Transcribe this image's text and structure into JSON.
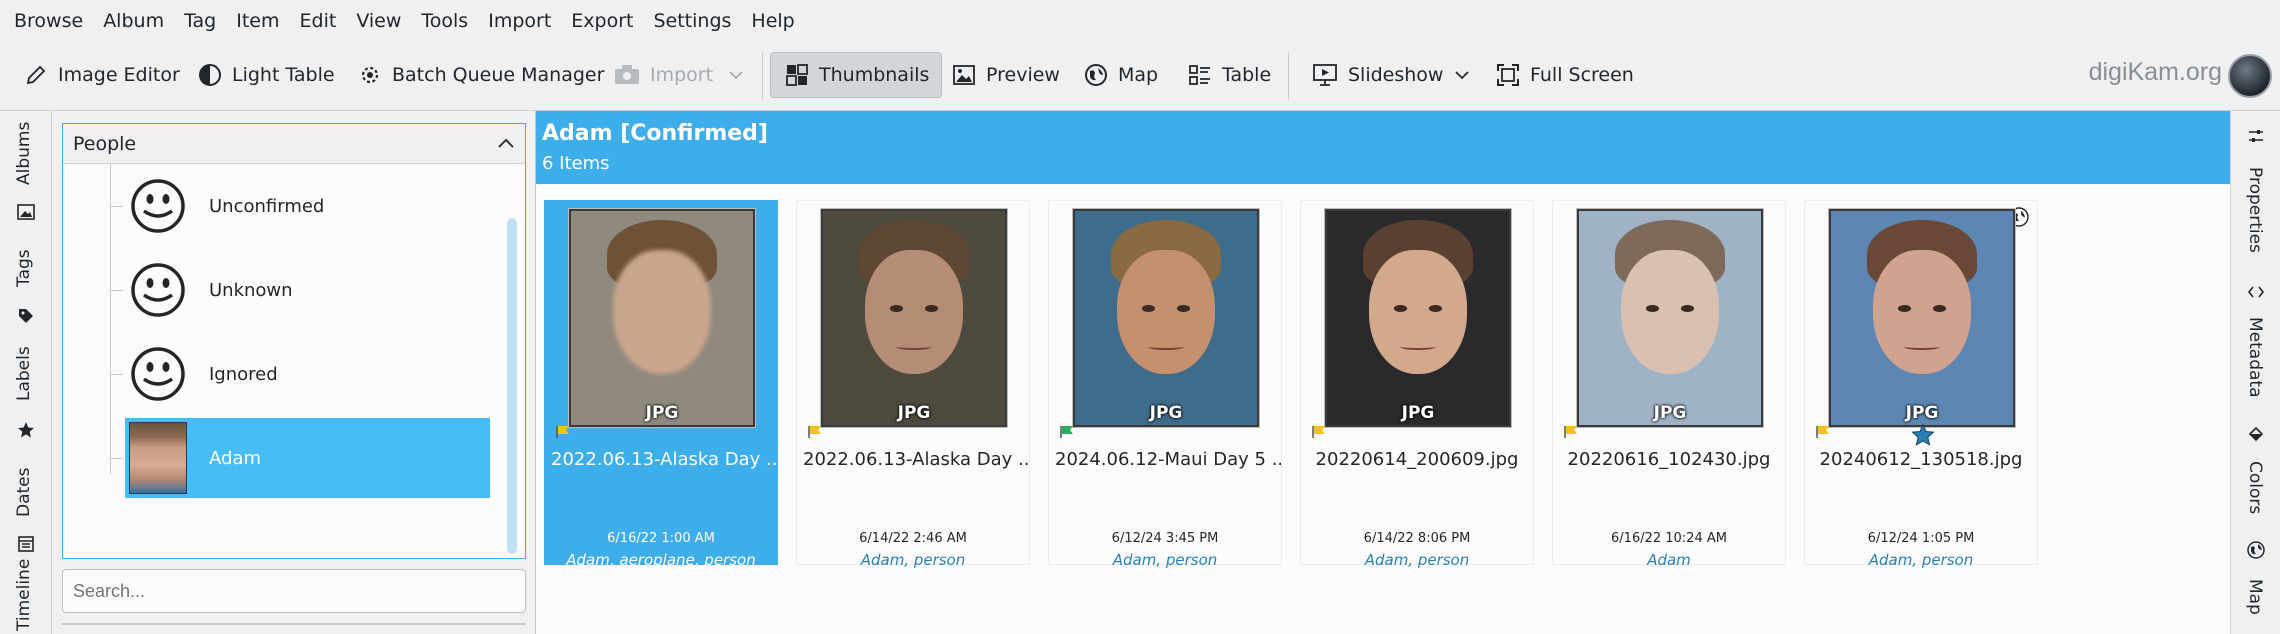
{
  "menubar": {
    "items": [
      "Browse",
      "Album",
      "Tag",
      "Item",
      "Edit",
      "View",
      "Tools",
      "Import",
      "Export",
      "Settings",
      "Help"
    ]
  },
  "toolbar": {
    "image_editor": "Image Editor",
    "light_table": "Light Table",
    "batch_queue": "Batch Queue Manager",
    "import": "Import",
    "thumbnails": "Thumbnails",
    "preview": "Preview",
    "map": "Map",
    "table": "Table",
    "slideshow": "Slideshow",
    "full_screen": "Full Screen",
    "brand": "digiKam.org"
  },
  "left_tabs": [
    "Albums",
    "Tags",
    "Labels",
    "Dates",
    "Timeline"
  ],
  "people_panel": {
    "title": "People",
    "items": [
      {
        "label": "Unconfirmed",
        "icon": "smiley-face-icon"
      },
      {
        "label": "Unknown",
        "icon": "smiley-face-icon"
      },
      {
        "label": "Ignored",
        "icon": "smiley-face-icon"
      },
      {
        "label": "Adam",
        "icon": "face-thumbnail",
        "selected": true
      }
    ],
    "search_placeholder": "Search..."
  },
  "content": {
    "title": "Adam [Confirmed]",
    "count": "6 Items",
    "items": [
      {
        "name": "2022.06.13-Alaska Day ...",
        "date": "6/16/22 1:00 AM",
        "tags": "Adam, aeroplane, person",
        "format": "JPG",
        "flag": "yellow",
        "selected": true
      },
      {
        "name": "2022.06.13-Alaska Day ...",
        "date": "6/14/22 2:46 AM",
        "tags": "Adam, person",
        "format": "JPG",
        "flag": "yellow"
      },
      {
        "name": "2024.06.12-Maui Day 5 ...",
        "date": "6/12/24 3:45 PM",
        "tags": "Adam, person",
        "format": "JPG",
        "flag": "green"
      },
      {
        "name": "20220614_200609.jpg",
        "date": "6/14/22 8:06 PM",
        "tags": "Adam, person",
        "format": "JPG",
        "flag": "yellow"
      },
      {
        "name": "20220616_102430.jpg",
        "date": "6/16/22 10:24 AM",
        "tags": "Adam",
        "format": "JPG",
        "flag": "yellow"
      },
      {
        "name": "20240612_130518.jpg",
        "date": "6/12/24 1:05 PM",
        "tags": "Adam, person",
        "format": "JPG",
        "flag": "yellow",
        "rating": 1,
        "geo": true
      }
    ]
  },
  "right_tabs": [
    "Properties",
    "Metadata",
    "Colors",
    "Map"
  ],
  "colors": {
    "accent": "#3daee9",
    "selection": "#47bcf5",
    "flag_yellow": "#f5c211",
    "flag_green": "#27ae60",
    "tag_text": "#2980b9"
  }
}
